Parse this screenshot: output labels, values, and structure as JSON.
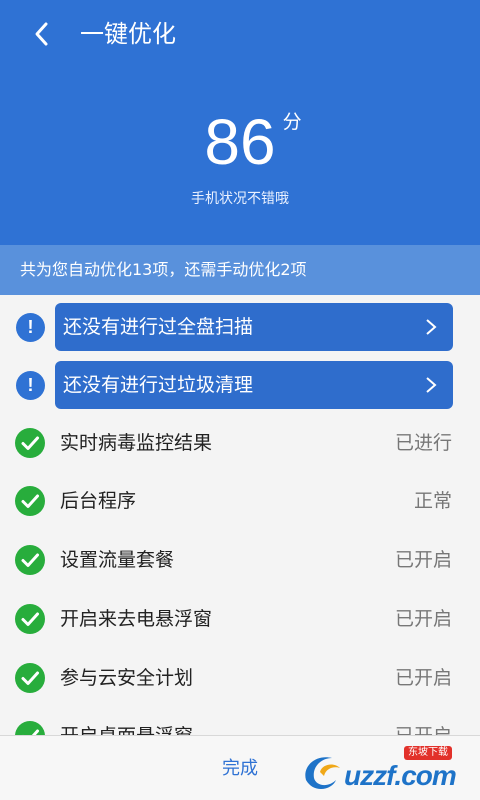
{
  "header": {
    "title": "一键优化",
    "score": "86",
    "score_unit": "分",
    "status": "手机状况不错哦",
    "background_color": "#2f72d4"
  },
  "summary": "共为您自动优化13项，还需手动优化2项",
  "warnings": [
    {
      "label": "还没有进行过全盘扫描",
      "icon": "exclamation-icon"
    },
    {
      "label": "还没有进行过垃圾清理",
      "icon": "exclamation-icon"
    }
  ],
  "items": [
    {
      "label": "实时病毒监控结果",
      "value": "已进行"
    },
    {
      "label": "后台程序",
      "value": "正常"
    },
    {
      "label": "设置流量套餐",
      "value": "已开启"
    },
    {
      "label": "开启来去电悬浮窗",
      "value": "已开启"
    },
    {
      "label": "参与云安全计划",
      "value": "已开启"
    },
    {
      "label": "开启桌面悬浮窗",
      "value": "已开启"
    }
  ],
  "footer": {
    "done_label": "完成"
  },
  "watermark": {
    "tag": "东坡下载",
    "text": "uzzf.com"
  }
}
